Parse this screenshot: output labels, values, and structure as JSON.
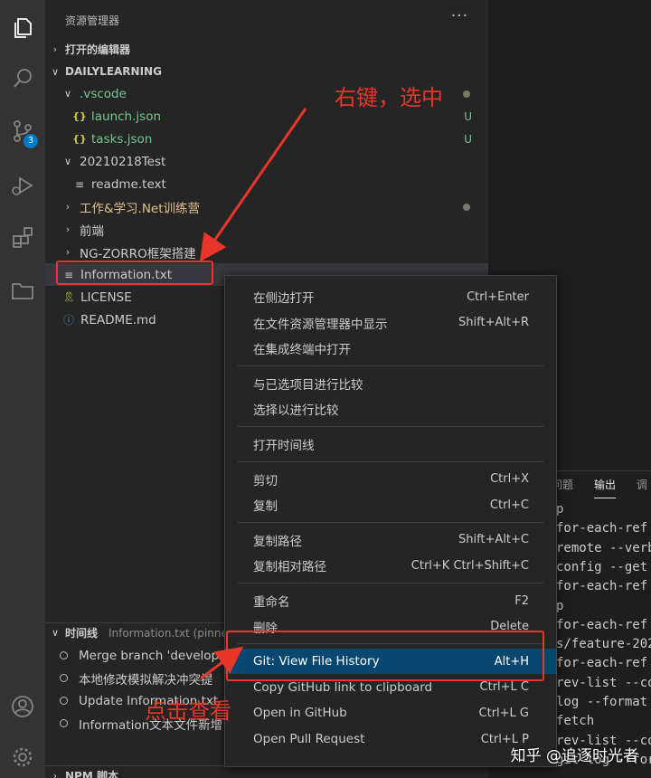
{
  "sidebar": {
    "title": "资源管理器",
    "more": "···",
    "open_editors": "打开的编辑器",
    "workspace": "DAILYLEARNING",
    "tree": [
      {
        "name": "vscode-folder",
        "label": ".vscode",
        "color": "#73c991",
        "chev": "∨",
        "ico": "",
        "status": "",
        "indent": 0
      },
      {
        "name": "launch-json",
        "label": "launch.json",
        "color": "#73c991",
        "chev": "",
        "ico": "{}",
        "status": "U",
        "indent": 1
      },
      {
        "name": "tasks-json",
        "label": "tasks.json",
        "color": "#73c991",
        "chev": "",
        "ico": "{}",
        "status": "U",
        "indent": 1
      },
      {
        "name": "folder-20210218test",
        "label": "20210218Test",
        "color": "#cccccc",
        "chev": "∨",
        "ico": "",
        "status": "",
        "indent": 0
      },
      {
        "name": "readme-text",
        "label": "readme.text",
        "color": "#cccccc",
        "chev": "",
        "ico": "≡",
        "status": "",
        "indent": 1
      },
      {
        "name": "folder-net",
        "label": "工作&学习.Net训练营",
        "color": "#e2c08d",
        "chev": "›",
        "ico": "",
        "status": "",
        "indent": 0
      },
      {
        "name": "folder-frontend",
        "label": "前端",
        "color": "#cccccc",
        "chev": "›",
        "ico": "",
        "status": "",
        "indent": 0
      },
      {
        "name": "folder-ngzorro",
        "label": "NG-ZORRO框架搭建",
        "color": "#cccccc",
        "chev": "›",
        "ico": "",
        "status": "",
        "indent": 0
      },
      {
        "name": "information-txt",
        "label": "Information.txt",
        "color": "#cccccc",
        "chev": "",
        "ico": "≡",
        "status": "",
        "indent": 0
      },
      {
        "name": "license",
        "label": "LICENSE",
        "color": "#cccccc",
        "chev": "",
        "ico": "license",
        "status": "",
        "indent": 0
      },
      {
        "name": "readme-md",
        "label": "README.md",
        "color": "#cccccc",
        "chev": "",
        "ico": "info",
        "status": "",
        "indent": 0
      }
    ],
    "timeline": {
      "title": "时间线",
      "subtitle": "Information.txt (pinned)",
      "items": [
        "Merge branch 'develop",
        "本地修改模拟解决冲突提",
        "Update Information.txt -",
        "Information文本文件新增"
      ]
    },
    "npm": "NPM 脚本"
  },
  "activity": {
    "scm_badge": "3"
  },
  "panel": {
    "tabs": [
      "问题",
      "输出",
      "调"
    ],
    "lines": [
      "p",
      "for-each-ref",
      "remote --verb",
      "config --get",
      "for-each-ref",
      "p",
      "for-each-ref",
      "s/feature-202",
      "for-each-ref",
      "rev-list --co",
      "log --format",
      "fetch",
      "rev-list --co",
      "git log --format"
    ]
  },
  "menu": {
    "groups": [
      [
        {
          "label": "在侧边打开",
          "shortcut": "Ctrl+Enter"
        },
        {
          "label": "在文件资源管理器中显示",
          "shortcut": "Shift+Alt+R"
        },
        {
          "label": "在集成终端中打开",
          "shortcut": ""
        }
      ],
      [
        {
          "label": "与已选项目进行比较",
          "shortcut": ""
        },
        {
          "label": "选择以进行比较",
          "shortcut": ""
        }
      ],
      [
        {
          "label": "打开时间线",
          "shortcut": ""
        }
      ],
      [
        {
          "label": "剪切",
          "shortcut": "Ctrl+X"
        },
        {
          "label": "复制",
          "shortcut": "Ctrl+C"
        }
      ],
      [
        {
          "label": "复制路径",
          "shortcut": "Shift+Alt+C"
        },
        {
          "label": "复制相对路径",
          "shortcut": "Ctrl+K Ctrl+Shift+C"
        }
      ],
      [
        {
          "label": "重命名",
          "shortcut": "F2"
        },
        {
          "label": "删除",
          "shortcut": "Delete"
        }
      ],
      [
        {
          "label": "Git: View File History",
          "shortcut": "Alt+H",
          "highlight": true
        },
        {
          "label": "Copy GitHub link to clipboard",
          "shortcut": "Ctrl+L C"
        },
        {
          "label": "Open in GitHub",
          "shortcut": "Ctrl+L G"
        },
        {
          "label": "Open Pull Request",
          "shortcut": "Ctrl+L P"
        }
      ]
    ]
  },
  "annotations": {
    "right_click": "右键，选中",
    "click_view": "点击查看",
    "color": "#e8362a"
  },
  "watermark": "知乎 @追逐时光者"
}
